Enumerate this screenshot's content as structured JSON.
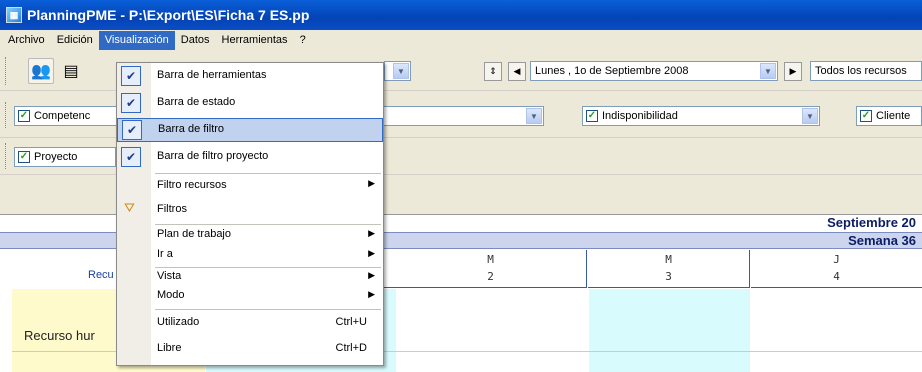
{
  "window": {
    "title": "PlanningPME - P:\\Export\\ES\\Ficha 7 ES.pp"
  },
  "menubar": {
    "items": [
      "Archivo",
      "Edición",
      "Visualización",
      "Datos",
      "Herramientas",
      "?"
    ],
    "active": "Visualización"
  },
  "toolbar": {
    "date_label": "Lunes  ,  1o de Septiembre 2008",
    "resources_label": "Todos los recursos"
  },
  "filter_bar": {
    "competencia_label": "Competenc",
    "indisponibilidad_label": "Indisponibilidad",
    "cliente_label": "Cliente"
  },
  "project_bar": {
    "proyecto_label": "Proyecto"
  },
  "calendar": {
    "month": "Septiembre 20",
    "week": "Semana 36",
    "resource_column_label": "Recu",
    "days": [
      {
        "letter": "M",
        "number": "2"
      },
      {
        "letter": "M",
        "number": "3"
      },
      {
        "letter": "J",
        "number": "4"
      }
    ],
    "row_label": "Recurso hur"
  },
  "view_menu": {
    "items": [
      {
        "label": "Barra de herramientas",
        "checked": true,
        "shortcut": "",
        "submenu": false
      },
      {
        "label": "Barra de estado",
        "checked": true,
        "shortcut": "",
        "submenu": false
      },
      {
        "label": "Barra de filtro",
        "checked": true,
        "shortcut": "",
        "submenu": false
      },
      {
        "label": "Barra de filtro proyecto",
        "checked": true,
        "shortcut": "",
        "submenu": false
      },
      {
        "label": "Filtro recursos",
        "checked": false,
        "shortcut": "",
        "submenu": true
      },
      {
        "label": "Filtros",
        "checked": false,
        "shortcut": "",
        "submenu": false
      },
      {
        "label": "Plan de trabajo",
        "checked": false,
        "shortcut": "",
        "submenu": true
      },
      {
        "label": "Ir a",
        "checked": false,
        "shortcut": "",
        "submenu": true
      },
      {
        "label": "Vista",
        "checked": false,
        "shortcut": "",
        "submenu": true
      },
      {
        "label": "Modo",
        "checked": false,
        "shortcut": "",
        "submenu": true
      },
      {
        "label": "Utilizado",
        "checked": false,
        "shortcut": "Ctrl+U",
        "submenu": false
      },
      {
        "label": "Libre",
        "checked": false,
        "shortcut": "Ctrl+D",
        "submenu": false
      }
    ],
    "highlighted": "Barra de filtro"
  },
  "colors": {
    "menu_highlight": "#316ac5",
    "today_column": "#d8fbfd",
    "resource_column": "#fffacc"
  }
}
